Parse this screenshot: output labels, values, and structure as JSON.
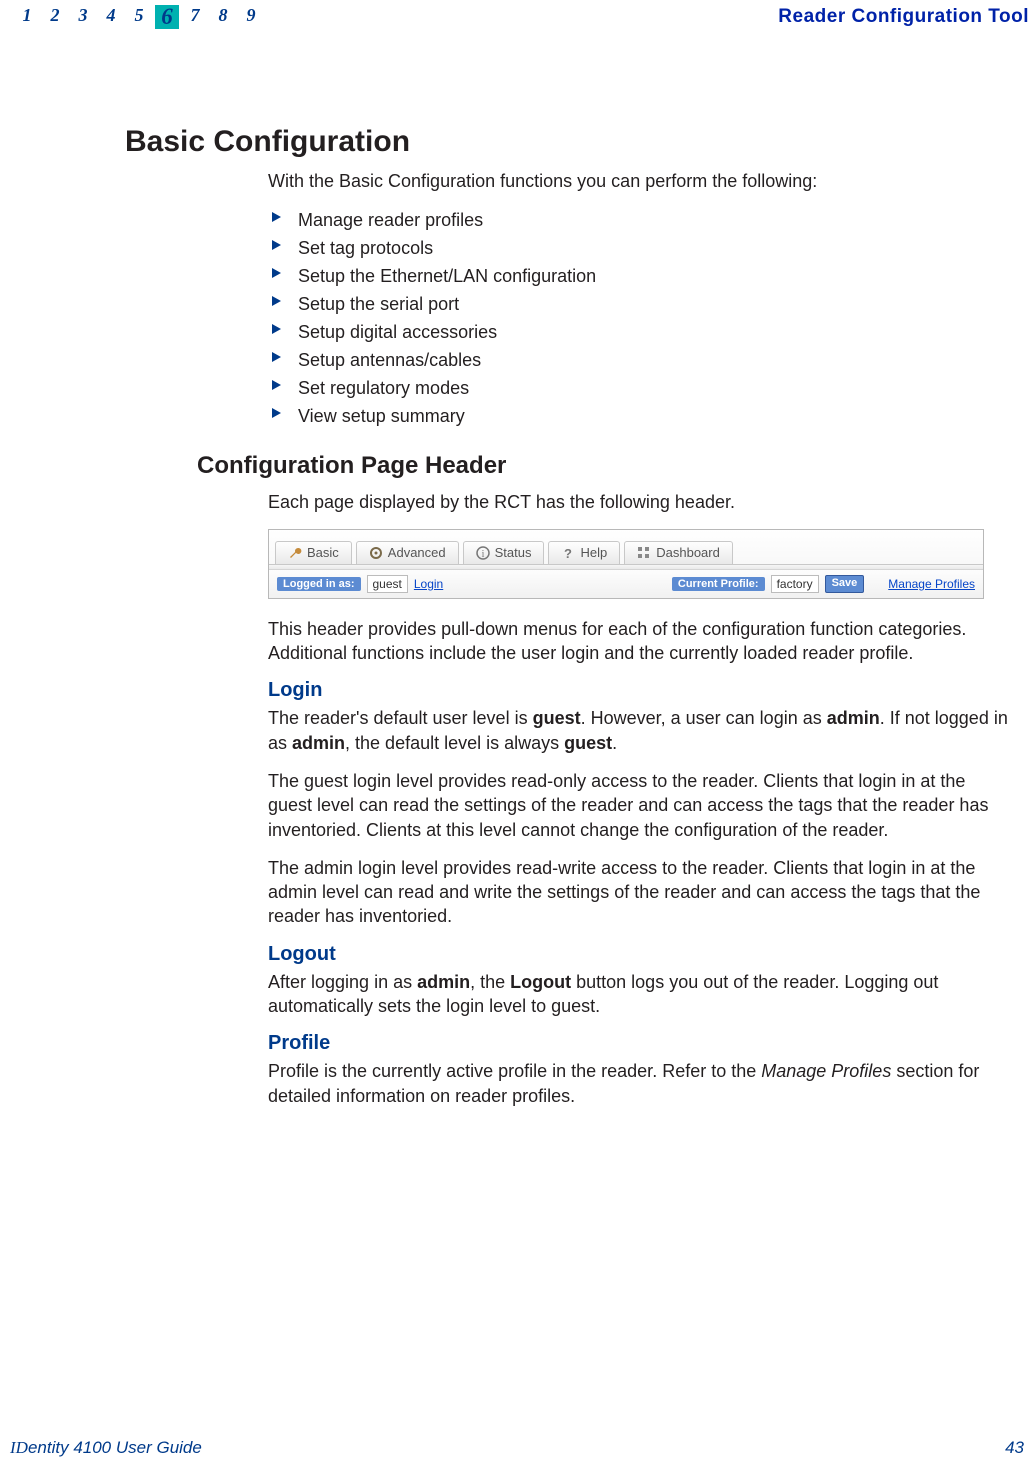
{
  "header": {
    "chapter_numbers": [
      "1",
      "2",
      "3",
      "4",
      "5",
      "6",
      "7",
      "8",
      "9"
    ],
    "current_chapter": "6",
    "doc_title": "Reader Configuration Tool"
  },
  "h1": "Basic Configuration",
  "intro": "With the Basic Configuration functions you can perform the following:",
  "bullets": [
    "Manage reader profiles",
    "Set tag protocols",
    "Setup the Ethernet/LAN configuration",
    "Setup the serial port",
    "Setup digital accessories",
    "Setup antennas/cables",
    "Set regulatory modes",
    "View setup summary"
  ],
  "h2": "Configuration Page Header",
  "h2_intro": "Each page displayed by the RCT has the following header.",
  "screenshot": {
    "tabs": {
      "basic": "Basic",
      "advanced": "Advanced",
      "status": "Status",
      "help": "Help",
      "dashboard": "Dashboard"
    },
    "row": {
      "logged_in_label": "Logged in as:",
      "user": "guest",
      "login_link": "Login",
      "profile_label": "Current Profile:",
      "profile_value": "factory",
      "save_btn": "Save",
      "manage_link": "Manage Profiles"
    }
  },
  "header_desc": "This header provides pull-down menus for each of the configuration function categories. Additional functions include the user login and the currently loaded reader profile.",
  "login": {
    "title": "Login",
    "p1_a": "The reader's default user level is ",
    "p1_b": "guest",
    "p1_c": ". However, a user can login as ",
    "p1_d": "admin",
    "p1_e": ". If not logged in as ",
    "p1_f": "admin",
    "p1_g": ", the default level is always ",
    "p1_h": "guest",
    "p1_i": ".",
    "p2": "The guest login level provides read-only access to the reader. Clients that login in at the guest level can read the settings of the reader and can access the tags that the reader has inventoried. Clients at this level cannot change the configuration of the reader.",
    "p3": "The admin login level provides read-write access to the reader. Clients that login in at the admin level can read and write the settings of the reader and can access the tags that the reader has inventoried."
  },
  "logout": {
    "title": "Logout",
    "p_a": "After logging in as ",
    "p_b": "admin",
    "p_c": ", the ",
    "p_d": "Logout",
    "p_e": " button logs you out of the reader. Logging out automatically sets the login level to guest."
  },
  "profile": {
    "title": "Profile",
    "p_a": "Profile is the currently active profile in the reader. Refer to the ",
    "p_b": "Manage Profiles",
    "p_c": " section for detailed information on reader profiles."
  },
  "footer": {
    "left_a": "ID",
    "left_b": "entity",
    "left_c": " 4100 User Guide",
    "page": "43"
  }
}
